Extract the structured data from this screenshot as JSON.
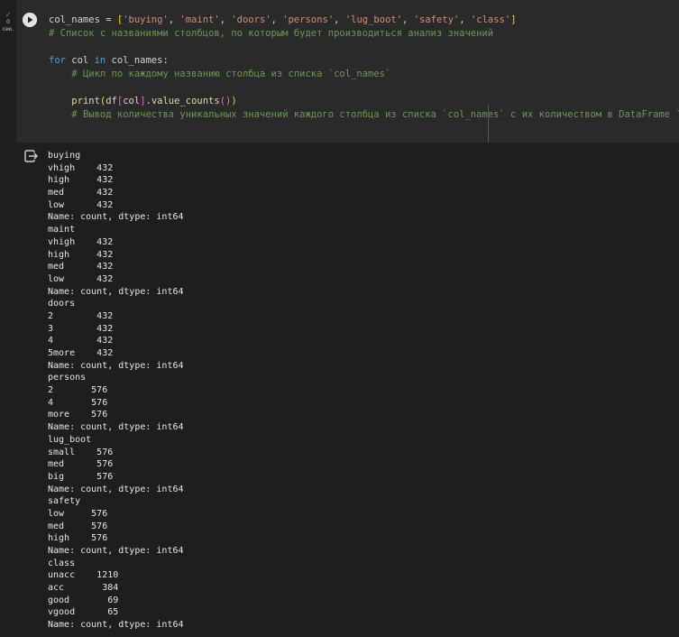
{
  "cell": {
    "exec_time_value": "0",
    "exec_time_unit": "сек.",
    "code_lines": [
      [
        [
          "op",
          "col_names = "
        ],
        [
          "br1",
          "["
        ],
        [
          "str",
          "'buying'"
        ],
        [
          "op",
          ", "
        ],
        [
          "str",
          "'maint'"
        ],
        [
          "op",
          ", "
        ],
        [
          "str",
          "'doors'"
        ],
        [
          "op",
          ", "
        ],
        [
          "str",
          "'persons'"
        ],
        [
          "op",
          ", "
        ],
        [
          "str",
          "'lug_boot'"
        ],
        [
          "op",
          ", "
        ],
        [
          "str",
          "'safety'"
        ],
        [
          "op",
          ", "
        ],
        [
          "str",
          "'class'"
        ],
        [
          "br1",
          "]"
        ]
      ],
      [
        [
          "cm",
          "# Список с названиями столбцов, по которым будет производиться анализ значений"
        ]
      ],
      [],
      [
        [
          "kw",
          "for"
        ],
        [
          "op",
          " col "
        ],
        [
          "kw",
          "in"
        ],
        [
          "op",
          " col_names:"
        ]
      ],
      [
        [
          "op",
          "    "
        ],
        [
          "cm",
          "# Цикл по каждому названию столбца из списка `col_names`"
        ]
      ],
      [],
      [
        [
          "op",
          "    "
        ],
        [
          "fn",
          "print"
        ],
        [
          "br1",
          "("
        ],
        [
          "op",
          "df"
        ],
        [
          "br2",
          "["
        ],
        [
          "op",
          "col"
        ],
        [
          "br2",
          "]"
        ],
        [
          "op",
          "."
        ],
        [
          "fn",
          "value_counts"
        ],
        [
          "br2",
          "()"
        ],
        [
          "br1",
          ")"
        ]
      ],
      [
        [
          "op",
          "    "
        ],
        [
          "cm",
          "# Вывод количества уникальных значений каждого столбца из списка `col_names` с их количеством в DataFrame `df`"
        ]
      ]
    ]
  },
  "output": {
    "lines": [
      "buying",
      "vhigh    432",
      "high     432",
      "med      432",
      "low      432",
      "Name: count, dtype: int64",
      "maint",
      "vhigh    432",
      "high     432",
      "med      432",
      "low      432",
      "Name: count, dtype: int64",
      "doors",
      "2        432",
      "3        432",
      "4        432",
      "5more    432",
      "Name: count, dtype: int64",
      "persons",
      "2       576",
      "4       576",
      "more    576",
      "Name: count, dtype: int64",
      "lug_boot",
      "small    576",
      "med      576",
      "big      576",
      "Name: count, dtype: int64",
      "safety",
      "low     576",
      "med     576",
      "high    576",
      "Name: count, dtype: int64",
      "class",
      "unacc    1210",
      "acc       384",
      "good       69",
      "vgood      65",
      "Name: count, dtype: int64"
    ]
  },
  "colors": {
    "background": "#1e1e1e",
    "cell_background": "#2a2a2a",
    "keyword": "#569cd6",
    "function": "#dcdcaa",
    "string": "#ce9178",
    "comment": "#6a9955",
    "success_check": "#4caf50"
  },
  "icons": {
    "run": "play-circle-icon",
    "status": "check-icon",
    "output": "output-exit-icon"
  }
}
